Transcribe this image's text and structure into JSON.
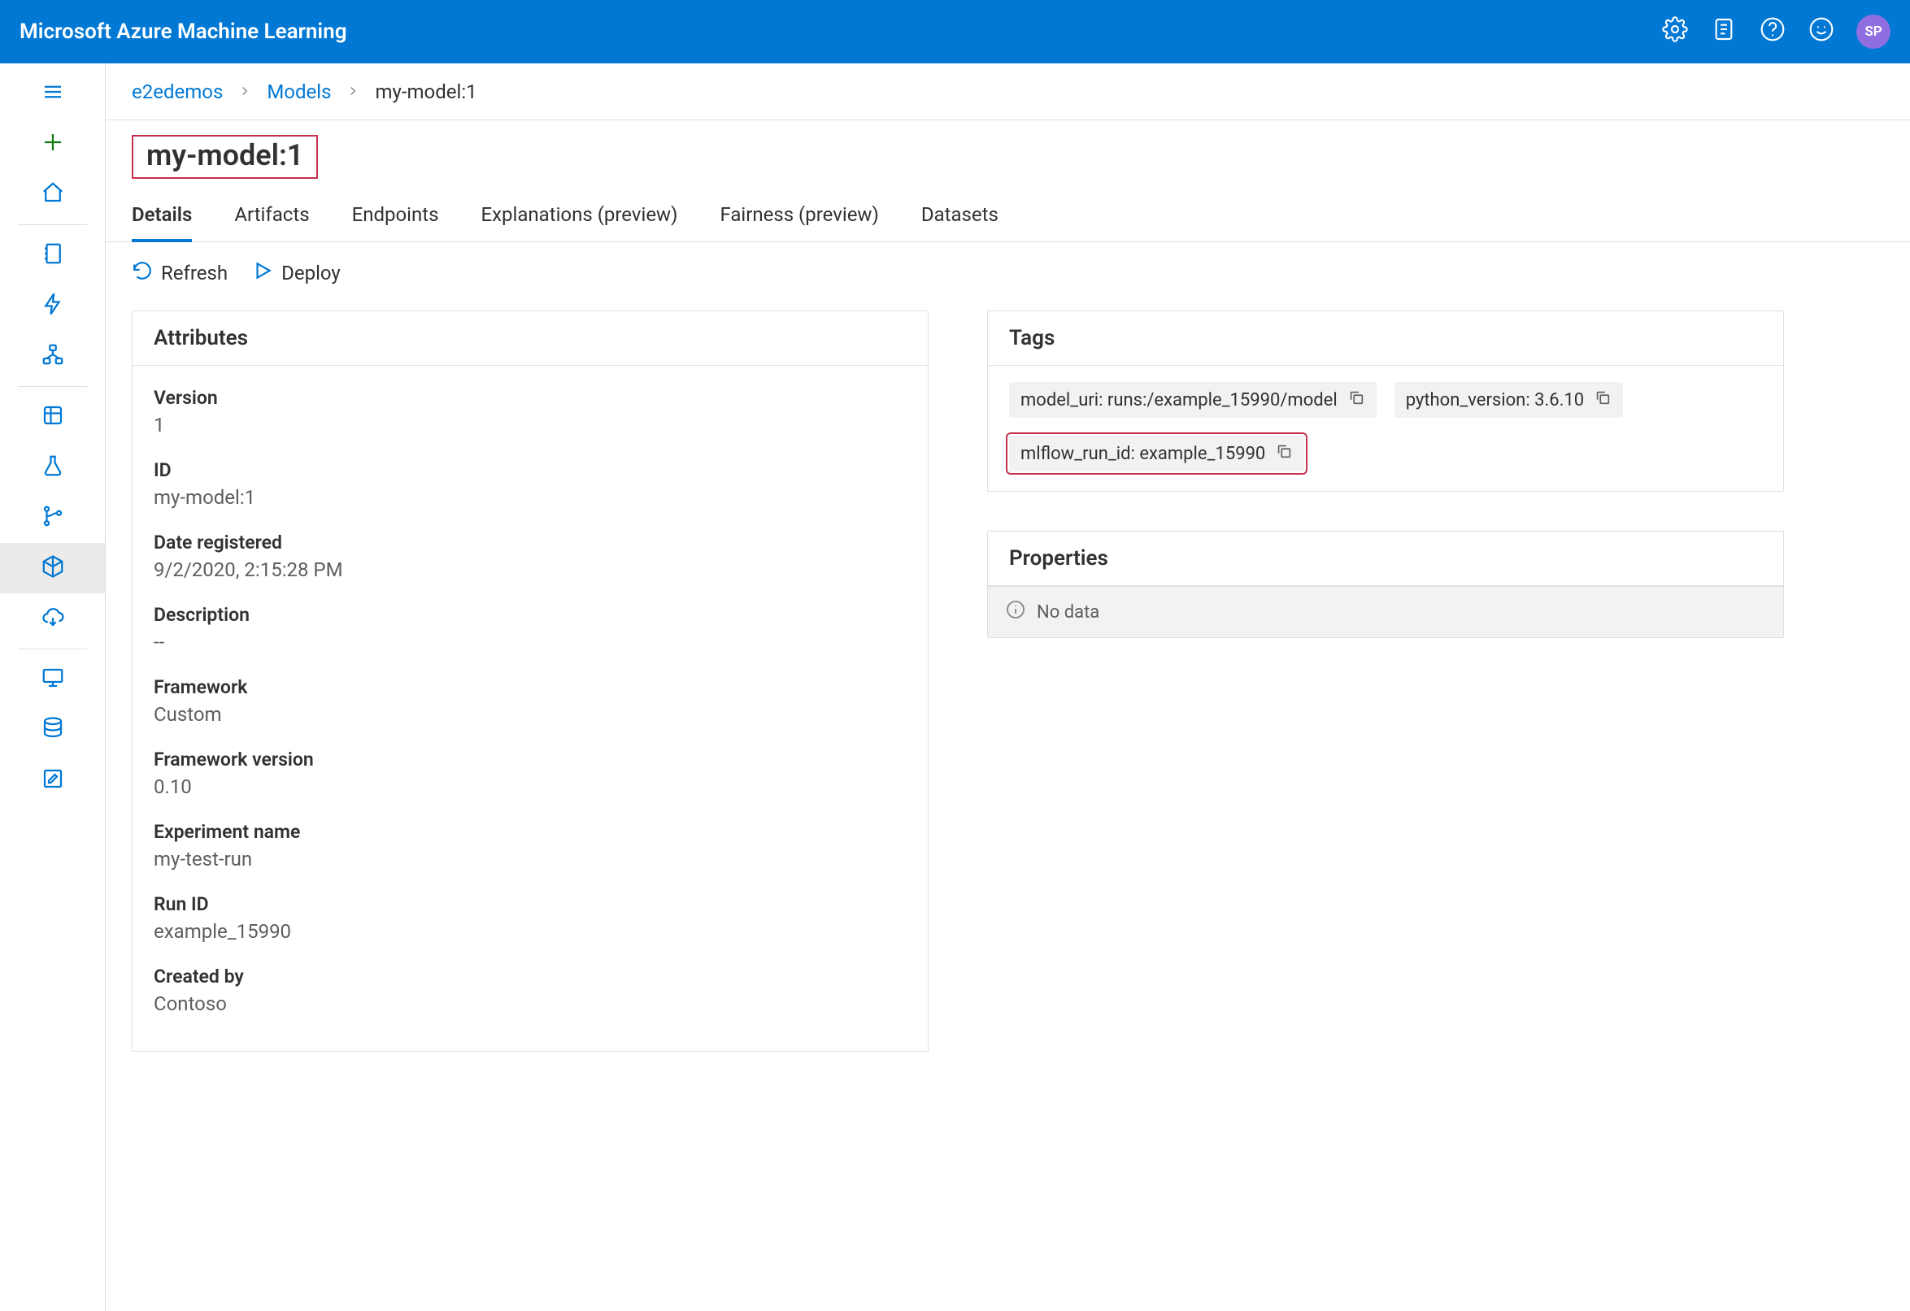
{
  "header": {
    "title": "Microsoft Azure Machine Learning",
    "avatar_initials": "SP"
  },
  "breadcrumb": {
    "workspace": "e2edemos",
    "section": "Models",
    "current": "my-model:1"
  },
  "page_title": "my-model:1",
  "tabs": {
    "details": "Details",
    "artifacts": "Artifacts",
    "endpoints": "Endpoints",
    "explanations": "Explanations (preview)",
    "fairness": "Fairness (preview)",
    "datasets": "Datasets"
  },
  "actions": {
    "refresh": "Refresh",
    "deploy": "Deploy"
  },
  "attributes": {
    "title": "Attributes",
    "items": [
      {
        "label": "Version",
        "value": "1"
      },
      {
        "label": "ID",
        "value": "my-model:1"
      },
      {
        "label": "Date registered",
        "value": "9/2/2020, 2:15:28 PM"
      },
      {
        "label": "Description",
        "value": "--"
      },
      {
        "label": "Framework",
        "value": "Custom"
      },
      {
        "label": "Framework version",
        "value": "0.10"
      },
      {
        "label": "Experiment name",
        "value": "my-test-run"
      },
      {
        "label": "Run ID",
        "value": "example_15990"
      },
      {
        "label": "Created by",
        "value": "Contoso"
      }
    ]
  },
  "tags": {
    "title": "Tags",
    "items": [
      {
        "text": "model_uri: runs:/example_15990/model",
        "highlight": false
      },
      {
        "text": "python_version: 3.6.10",
        "highlight": false
      },
      {
        "text": "mlflow_run_id: example_15990",
        "highlight": true
      }
    ]
  },
  "properties": {
    "title": "Properties",
    "no_data": "No data"
  }
}
